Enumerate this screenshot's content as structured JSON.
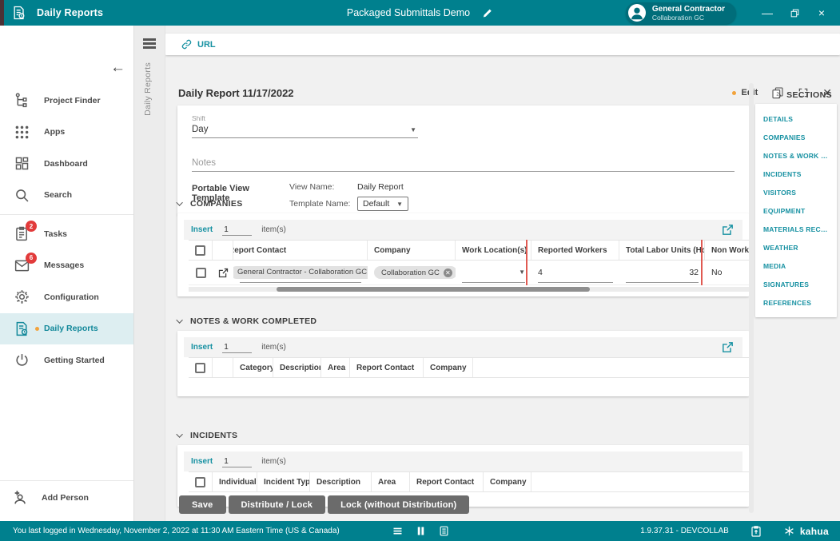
{
  "colors": {
    "topbar_teal": "#00808e",
    "accent_teal_link": "#1791a2",
    "active_item_bg": "#ddeef1",
    "badge_red": "#e23b3b",
    "highlight_red_border": "#e05a52",
    "orange_indicator": "#f2a33c",
    "button_gray": "#6b6b6b"
  },
  "window": {
    "app_title": "Daily Reports",
    "project_title": "Packaged Submittals Demo",
    "user": {
      "name": "General Contractor",
      "org": "Collaboration GC"
    }
  },
  "sidebar": {
    "items": [
      {
        "label": "Project Finder"
      },
      {
        "label": "Apps"
      },
      {
        "label": "Dashboard"
      },
      {
        "label": "Search"
      },
      {
        "label": "Tasks",
        "badge": "2"
      },
      {
        "label": "Messages",
        "badge": "6"
      },
      {
        "label": "Configuration"
      },
      {
        "label": "Daily Reports",
        "active": true
      },
      {
        "label": "Getting Started"
      }
    ],
    "add_person_label": "Add Person"
  },
  "vertical_tab_label": "Daily Reports",
  "main": {
    "url_label": "URL",
    "title": "Daily Report 11/17/2022",
    "edit_label": "Edit",
    "details": {
      "shift_label": "Shift",
      "shift_value": "Day",
      "notes_placeholder": "Notes",
      "pvt_label": "Portable View Template",
      "view_name_label": "View Name:",
      "view_name_value": "Daily Report",
      "template_name_label": "Template Name:",
      "template_name_value": "Default"
    },
    "companies": {
      "title": "COMPANIES",
      "insert_label": "Insert",
      "insert_value": "1",
      "items_label": "item(s)",
      "columns": {
        "report_contact": "Report Contact",
        "company": "Company",
        "work_location": "Work Location(s)",
        "reported_workers": "Reported Workers",
        "total_labor_units": "Total Labor Units (Hours)",
        "non_work": "Non Work"
      },
      "row": {
        "report_contact": "General Contractor - Collaboration GC",
        "company": "Collaboration GC",
        "reported_workers": "4",
        "total_labor_units": "32",
        "non_work": "No"
      }
    },
    "notes_work": {
      "title": "NOTES & WORK COMPLETED",
      "insert_label": "Insert",
      "insert_value": "1",
      "items_label": "item(s)",
      "columns": [
        "Category",
        "Description",
        "Area",
        "Report Contact",
        "Company"
      ]
    },
    "incidents": {
      "title": "INCIDENTS",
      "insert_label": "Insert",
      "insert_value": "1",
      "items_label": "item(s)",
      "columns": [
        "Individual",
        "Incident Type",
        "Description",
        "Area",
        "Report Contact",
        "Company"
      ]
    },
    "buttons": {
      "save": "Save",
      "distribute_lock": "Distribute / Lock",
      "lock_without": "Lock (without Distribution)"
    }
  },
  "sections_panel": {
    "header": "SECTIONS",
    "items": [
      "DETAILS",
      "COMPANIES",
      "NOTES & WORK COMPLETED",
      "INCIDENTS",
      "VISITORS",
      "EQUIPMENT",
      "MATERIALS RECEIVED",
      "WEATHER",
      "MEDIA",
      "SIGNATURES",
      "REFERENCES"
    ]
  },
  "statusbar": {
    "login_message": "You last logged in Wednesday, November 2, 2022 at 11:30 AM Eastern Time (US & Canada)",
    "version": "1.9.37.31 - DEVCOLLAB",
    "brand": "kahua"
  }
}
